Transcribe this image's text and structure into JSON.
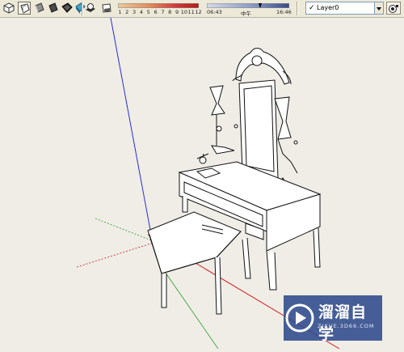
{
  "toolbar": {
    "tools": [
      {
        "name": "iso-view-icon"
      },
      {
        "name": "xray-style-icon"
      },
      {
        "name": "shaded-style-icon"
      },
      {
        "name": "textured-style-icon"
      },
      {
        "name": "monochrome-style-icon"
      },
      {
        "name": "shadows-toggle-icon"
      },
      {
        "name": "fog-icon"
      }
    ],
    "shadow_ramp": {
      "numbers": [
        "1",
        "2",
        "3",
        "4",
        "5",
        "6",
        "7",
        "8",
        "9",
        "10",
        "11",
        "12"
      ]
    },
    "time_slider": {
      "start_time": "06:43",
      "mid_label": "中午",
      "end_time": "16:46"
    },
    "layer": {
      "current": "Layer0",
      "check_glyph": "✓"
    }
  },
  "watermark": {
    "title": "溜溜自学",
    "url": "ZIXUE.3D66.COM"
  },
  "colors": {
    "blue_axis": "#2a2fd0",
    "red_axis": "#d02020",
    "green_axis": "#2c9a2c",
    "watermark_bg": "#2f4a8c"
  }
}
